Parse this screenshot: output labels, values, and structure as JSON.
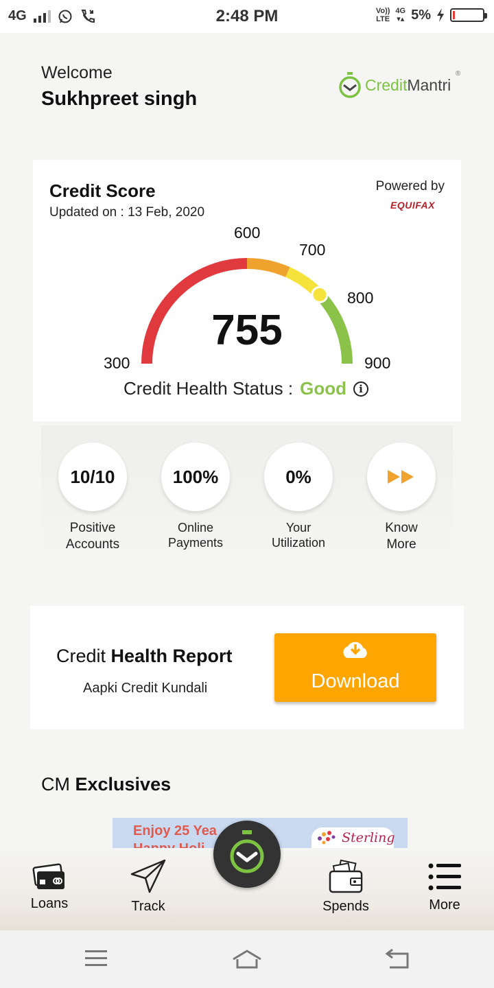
{
  "status_bar": {
    "network": "4G",
    "time": "2:48 PM",
    "volte": "Vo))",
    "lte": "LTE",
    "net2": "4G",
    "battery": "5%"
  },
  "header": {
    "welcome": "Welcome",
    "username": "Sukhpreet singh",
    "logo_part1": "Credit",
    "logo_part2": "Mantri",
    "logo_reg": "®"
  },
  "credit_score": {
    "title": "Credit Score",
    "updated": "Updated on : 13 Feb, 2020",
    "powered_by": "Powered by",
    "bureau": "EQUIFAX",
    "score": "755",
    "score_numeric": 755,
    "ticks": [
      "300",
      "600",
      "700",
      "800",
      "900"
    ],
    "status_label": "Credit Health Status :",
    "status_value": "Good",
    "info_glyph": "i"
  },
  "stats": [
    {
      "value": "10/10",
      "label_line1": "Positive",
      "label_line2": "Accounts"
    },
    {
      "value": "100%",
      "label_line1": "Online",
      "label_line2": "Payments"
    },
    {
      "value": "0%",
      "label_line1": "Your",
      "label_line2": "Utilization"
    },
    {
      "icon": "fast-forward-icon",
      "label_line1": "Know",
      "label_line2": "More"
    }
  ],
  "report": {
    "title_regular": "Credit ",
    "title_bold": "Health Report",
    "subtitle": "Aapki Credit Kundali",
    "button_label": "Download"
  },
  "exclusives": {
    "title_regular": "CM ",
    "title_bold": "Exclusives",
    "banner_line1": "Enjoy 25 Yea",
    "banner_line2": "Happy Holi",
    "banner_brand": "Sterling"
  },
  "bottom_nav": [
    {
      "label": "Loans",
      "icon": "credit-cards-icon"
    },
    {
      "label": "Track",
      "icon": "send-arrow-icon"
    },
    {
      "label": "Spends",
      "icon": "wallet-icon"
    },
    {
      "label": "More",
      "icon": "menu-list-icon"
    }
  ],
  "colors": {
    "brand_green": "#7dc242",
    "good": "#8bc34a",
    "gauge_red": "#e0393e",
    "gauge_orange": "#f0a22e",
    "gauge_yellow": "#f5e33b",
    "gauge_green": "#8bc34a",
    "download": "#ffa500",
    "equifax": "#b51f2a"
  }
}
